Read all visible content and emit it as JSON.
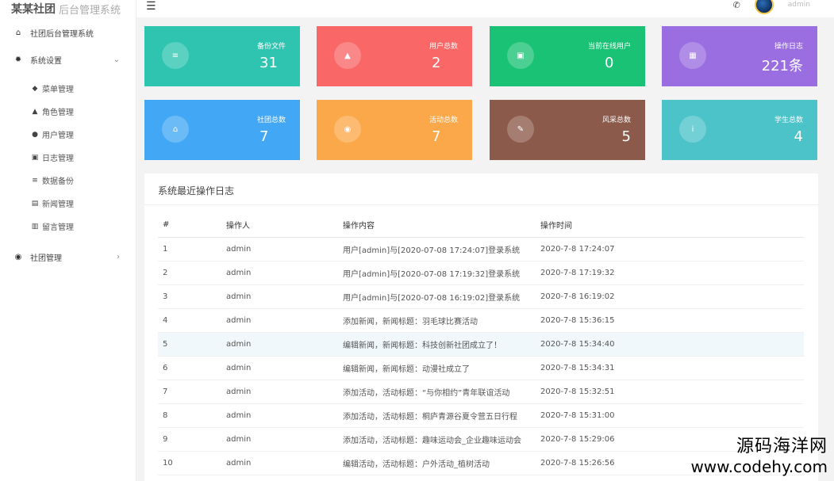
{
  "brand": {
    "name": "某某社团",
    "sub": "后台管理系统"
  },
  "topbar": {
    "username": "admin"
  },
  "sidebar": {
    "items": [
      {
        "icon": "home-icon",
        "glyph": "⌂",
        "label": "社团后台管理系统"
      },
      {
        "icon": "gear-icon",
        "glyph": "✹",
        "label": "系统设置",
        "chevron": "⌄"
      }
    ],
    "sub_items": [
      {
        "name": "menu",
        "glyph": "◆",
        "label": "菜单管理"
      },
      {
        "name": "role",
        "glyph": "▲",
        "label": "角色管理"
      },
      {
        "name": "user",
        "glyph": "●",
        "label": "用户管理"
      },
      {
        "name": "log",
        "glyph": "▣",
        "label": "日志管理"
      },
      {
        "name": "backup",
        "glyph": "≡",
        "label": "数据备份"
      },
      {
        "name": "news",
        "glyph": "▤",
        "label": "新闻管理"
      },
      {
        "name": "message",
        "glyph": "▥",
        "label": "留言管理"
      }
    ],
    "club": {
      "glyph": "◉",
      "label": "社团管理",
      "chevron": "›"
    }
  },
  "cards": [
    {
      "label": "备份文件",
      "value": "31",
      "color": "#2ec4b0",
      "icon": "database-icon",
      "glyph": "≡"
    },
    {
      "label": "用户总数",
      "value": "2",
      "color": "#f96767",
      "icon": "user-icon",
      "glyph": "▲"
    },
    {
      "label": "当前在线用户",
      "value": "0",
      "color": "#19c274",
      "icon": "id-card-icon",
      "glyph": "▣"
    },
    {
      "label": "操作日志",
      "value": "221条",
      "color": "#9a6ee0",
      "icon": "calendar-icon",
      "glyph": "▦"
    },
    {
      "label": "社团总数",
      "value": "7",
      "color": "#42a8f5",
      "icon": "home-icon",
      "glyph": "⌂"
    },
    {
      "label": "活动总数",
      "value": "7",
      "color": "#fba84a",
      "icon": "target-icon",
      "glyph": "◉"
    },
    {
      "label": "风采总数",
      "value": "5",
      "color": "#8c5a4a",
      "icon": "feather-icon",
      "glyph": "✎"
    },
    {
      "label": "学生总数",
      "value": "4",
      "color": "#4cc3c9",
      "icon": "info-icon",
      "glyph": "i"
    }
  ],
  "log_panel": {
    "title": "系统最近操作日志",
    "columns": [
      "#",
      "操作人",
      "操作内容",
      "操作时间"
    ],
    "rows": [
      {
        "no": "1",
        "user": "admin",
        "content": "用户[admin]与[2020-07-08 17:24:07]登录系统",
        "time": "2020-7-8 17:24:07"
      },
      {
        "no": "2",
        "user": "admin",
        "content": "用户[admin]与[2020-07-08 17:19:32]登录系统",
        "time": "2020-7-8 17:19:32"
      },
      {
        "no": "3",
        "user": "admin",
        "content": "用户[admin]与[2020-07-08 16:19:02]登录系统",
        "time": "2020-7-8 16:19:02"
      },
      {
        "no": "4",
        "user": "admin",
        "content": "添加新闻，新闻标题：羽毛球比赛活动",
        "time": "2020-7-8 15:36:15"
      },
      {
        "no": "5",
        "user": "admin",
        "content": "编辑新闻，新闻标题：科技创新社团成立了！",
        "time": "2020-7-8 15:34:40"
      },
      {
        "no": "6",
        "user": "admin",
        "content": "编辑新闻，新闻标题：动漫社成立了",
        "time": "2020-7-8 15:34:31"
      },
      {
        "no": "7",
        "user": "admin",
        "content": "添加活动，活动标题：“与你相约”青年联谊活动",
        "time": "2020-7-8 15:32:51"
      },
      {
        "no": "8",
        "user": "admin",
        "content": "添加活动，活动标题：桐庐青源谷夏令营五日行程",
        "time": "2020-7-8 15:31:00"
      },
      {
        "no": "9",
        "user": "admin",
        "content": "添加活动，活动标题：趣味运动会_企业趣味运动会",
        "time": "2020-7-8 15:29:06"
      },
      {
        "no": "10",
        "user": "admin",
        "content": "编辑活动，活动标题：户外活动_植树活动",
        "time": "2020-7-8 15:26:56"
      }
    ]
  },
  "watermark": {
    "line1": "源码海洋网",
    "line2": "www.codehy.com"
  }
}
